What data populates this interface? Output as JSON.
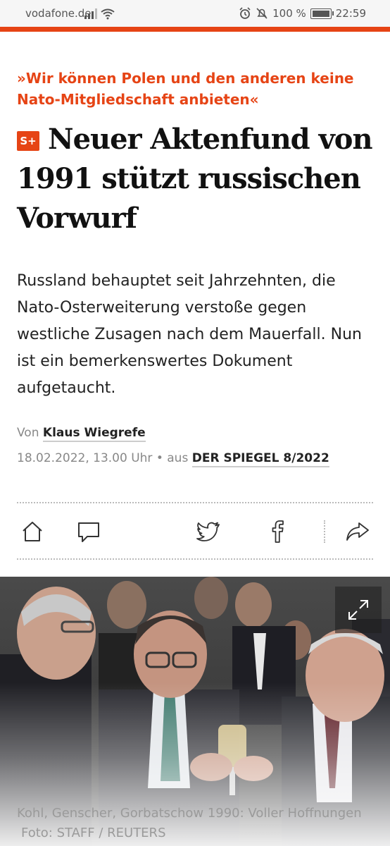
{
  "status_bar": {
    "carrier": "vodafone.de",
    "battery": "100 %",
    "battery_level_percent": 100,
    "time": "22:59"
  },
  "article": {
    "kicker": "»Wir können Polen und den anderen keine Nato-Mitgliedschaft anbieten«",
    "badge": "S+",
    "headline": "Neuer Aktenfund von 1991 stützt russischen Vorwurf",
    "lead": "Russland behauptet seit Jahrzehnten, die Nato-Osterweiterung verstoße gegen westliche Zusagen nach dem Mauerfall. Nun ist ein bemerkenswertes Dokument aufgetaucht.",
    "byline_prefix": "Von",
    "author": "Klaus Wiegrefe",
    "date": "18.02.2022, 13.00 Uhr",
    "separator": "•",
    "source_prefix": "aus",
    "issue": "DER SPIEGEL 8/2022"
  },
  "actions": [
    {
      "name": "home-button",
      "icon": "home-icon"
    },
    {
      "name": "comments-button",
      "icon": "comment-icon"
    },
    {
      "name": "twitter-share-button",
      "icon": "twitter-icon"
    },
    {
      "name": "facebook-share-button",
      "icon": "facebook-icon"
    },
    {
      "name": "share-button",
      "icon": "share-icon"
    }
  ],
  "photo": {
    "caption": "Kohl, Genscher, Gorbatschow 1990: Voller Hoffnungen",
    "credit": "Foto: STAFF / REUTERS",
    "expand_icon": "expand-icon"
  },
  "colors": {
    "accent": "#e64415",
    "text": "#222222",
    "muted": "#888888"
  }
}
